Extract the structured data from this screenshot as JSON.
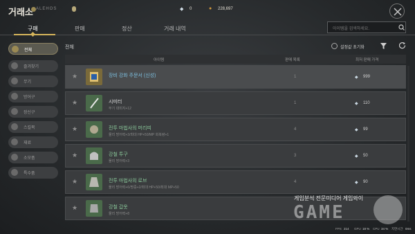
{
  "header": {
    "title": "거래소",
    "logo_text": "ALEHOS",
    "currency_1": {
      "value": "0",
      "icon": "diamond-icon"
    },
    "currency_2": {
      "value": "228,697",
      "icon": "gold-icon"
    }
  },
  "tabs": [
    {
      "label": "구매",
      "active": true
    },
    {
      "label": "판매",
      "active": false
    },
    {
      "label": "정산",
      "active": false
    },
    {
      "label": "거래 내역",
      "active": false
    }
  ],
  "search": {
    "placeholder": "아이템을 검색하세요."
  },
  "sidebar": {
    "items": [
      {
        "label": "전체",
        "active": true
      },
      {
        "label": "즐겨찾기",
        "active": false
      },
      {
        "label": "무기",
        "active": false
      },
      {
        "label": "방어구",
        "active": false
      },
      {
        "label": "장신구",
        "active": false
      },
      {
        "label": "스킬북",
        "active": false
      },
      {
        "label": "재료",
        "active": false
      },
      {
        "label": "소모품",
        "active": false
      },
      {
        "label": "특수품",
        "active": false
      }
    ]
  },
  "breadcrumb": "전체",
  "toolbar": {
    "reset_label": "설정값 초기화"
  },
  "table": {
    "headers": {
      "item": "아이템",
      "count": "판매 목록",
      "price": "최저 판매 가격"
    },
    "rows": [
      {
        "name": "장비 강화 주문서 (신성)",
        "sub": "",
        "count": "1",
        "price": "999",
        "color": "#7dc0e0"
      },
      {
        "name": "시미터",
        "sub": "무기 대미지+12",
        "count": "1",
        "price": "110",
        "color": "#e0e0e0"
      },
      {
        "name": "전투 마법사의 머리띠",
        "sub": "물리 방어력+3/최대 HP+50/MP 회복량+1",
        "count": "4",
        "price": "99",
        "color": "#8ac89a"
      },
      {
        "name": "강철 투구",
        "sub": "물리 방어력+3",
        "count": "3",
        "price": "50",
        "color": "#8ac89a"
      },
      {
        "name": "전투 마법사의 로브",
        "sub": "물리 방어력+6/명중+2/최대 HP+50/최대 MP+50",
        "count": "4",
        "price": "90",
        "color": "#8ac89a"
      },
      {
        "name": "강철 갑옷",
        "sub": "물리 방어력+8",
        "count": "",
        "price": "",
        "color": "#8ac89a"
      }
    ]
  },
  "watermark": {
    "caption": "게임분석 전문미디어 게임와이",
    "big": "GAME"
  },
  "status": {
    "fps_label": "FPS",
    "fps": "214",
    "gpu_label": "GPU",
    "gpu": "18 %",
    "cpu_label": "CPU",
    "cpu": "34 %",
    "time_label": "지연시간",
    "time": "0ms"
  }
}
